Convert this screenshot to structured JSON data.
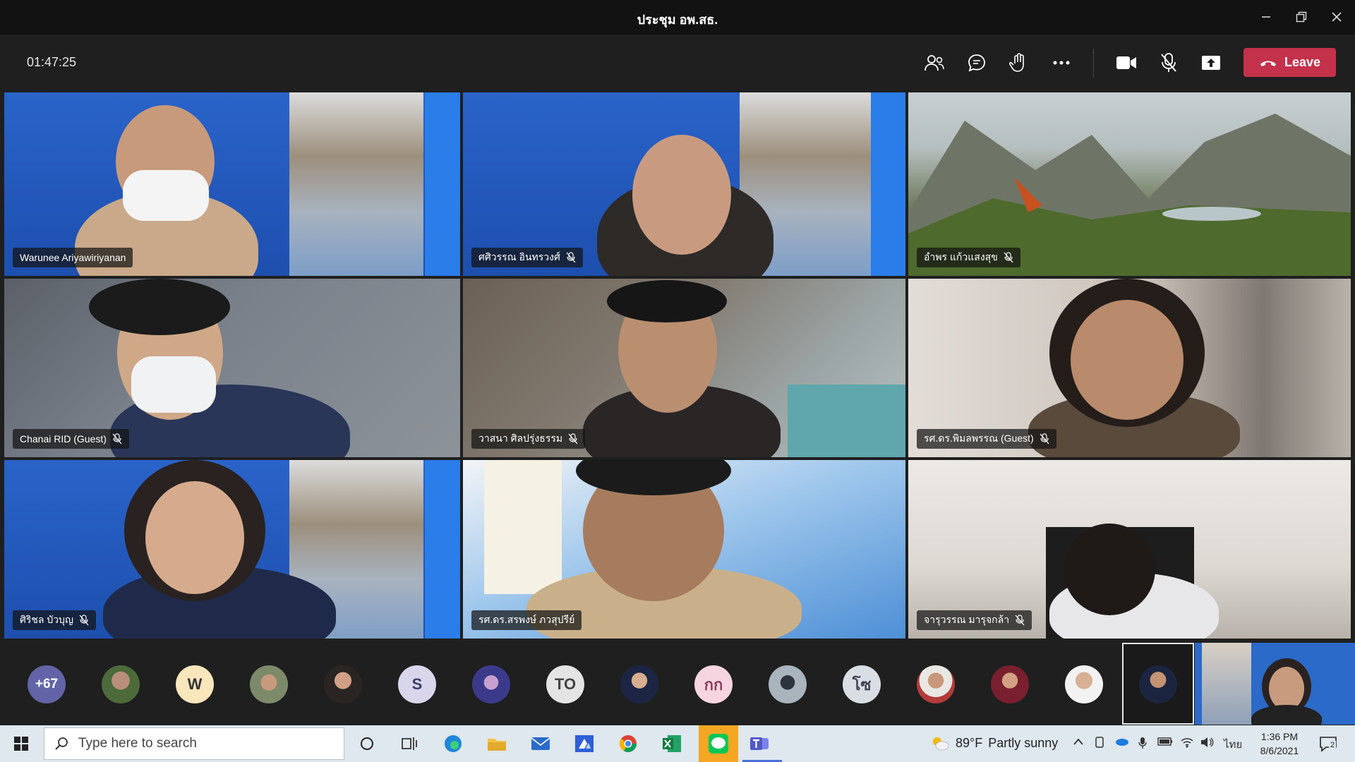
{
  "window": {
    "title": "ประชุม อพ.สธ."
  },
  "toolbar": {
    "timer": "01:47:25",
    "leave_label": "Leave",
    "icons": [
      "participants-icon",
      "chat-icon",
      "reactions-icon",
      "more-icon",
      "camera-icon",
      "mic-off-icon",
      "share-icon"
    ]
  },
  "tiles": [
    {
      "name": "Warunee Ariyawiriyanan",
      "muted": false
    },
    {
      "name": "ศศิวรรณ อินทรวงศ์",
      "muted": true
    },
    {
      "name": "อำพร แก้วแสงสุข",
      "muted": true
    },
    {
      "name": "Chanai RID (Guest)",
      "muted": true
    },
    {
      "name": "วาสนา ศิลปรุ่งธรรม",
      "muted": true
    },
    {
      "name": "รศ.ดร.พิมลพรรณ (Guest)",
      "muted": true
    },
    {
      "name": "ศิริชล บัวบุญ",
      "muted": true
    },
    {
      "name": "รศ.ดร.สรพงษ์ ภวสุปรีย์",
      "muted": false
    },
    {
      "name": "จารุวรรณ มารุจกล้า",
      "muted": true
    }
  ],
  "participants_bar": {
    "overflow_count": "+67",
    "initials": {
      "w": "W",
      "s": "S",
      "to": "TO",
      "kk": "กก",
      "so": "โซ"
    }
  },
  "taskbar": {
    "search_placeholder": "Type here to search",
    "weather_temp": "89°F",
    "weather_desc": "Partly sunny",
    "language": "ไทย",
    "time": "1:36 PM",
    "date": "8/6/2021",
    "notification_count": "2"
  },
  "colors": {
    "leave": "#c4314b",
    "titlebar": "#121212",
    "background": "#1f1f1f"
  }
}
